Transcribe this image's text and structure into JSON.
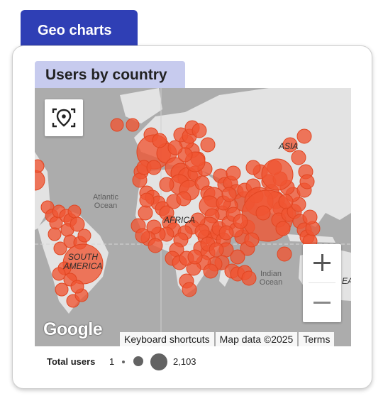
{
  "tab": {
    "label": "Geo charts"
  },
  "chart": {
    "title": "Users by country",
    "map_labels": {
      "asia": "ASIA",
      "africa": "AFRICA",
      "south_america": "SOUTH\nAMERICA",
      "atlantic": "Atlantic\nOcean",
      "indian": "Indian\nOcean",
      "partial_right": "EA"
    },
    "controls": {
      "recenter_icon": "location-target-icon",
      "zoom_in": "+",
      "zoom_out": "−"
    },
    "attribution": {
      "logo": "Google",
      "keyboard": "Keyboard shortcuts",
      "map_data": "Map data ©2025",
      "terms": "Terms"
    },
    "legend": {
      "label": "Total users",
      "min": "1",
      "max": "2,103"
    },
    "colors": {
      "bubble": "#ef5532",
      "land": "#e3e3e3",
      "water": "#acacac",
      "tab": "#2f3fb5",
      "title_bg": "#c7cbee"
    }
  }
}
